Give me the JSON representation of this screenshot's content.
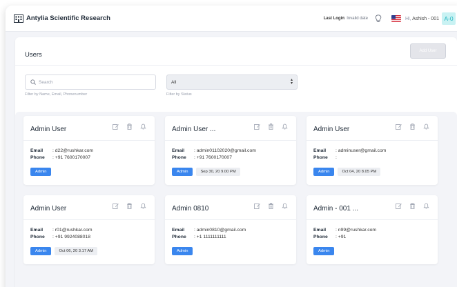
{
  "header": {
    "brand": "Antylia Scientific Research",
    "last_login_label": "Last Login",
    "last_login_value": ": Invalid date",
    "greeting_prefix": "Hi,",
    "user_name": "Ashish - 001",
    "avatar_initials": "A-0",
    "icons": [
      "building-icon",
      "lightbulb-icon",
      "us-flag-icon"
    ]
  },
  "page": {
    "title": "Users",
    "add_button_label": "Add User"
  },
  "filters": {
    "search_placeholder": "Search",
    "search_value": "",
    "search_hint": "Filter by Name, Email, Phonenumber",
    "status_value": "All",
    "status_hint": "Filter by Status"
  },
  "colors": {
    "accent": "#3a86ee",
    "avatar_bg": "#c9f2f3",
    "avatar_fg": "#21b4c0"
  },
  "labels": {
    "email": "Email",
    "phone": "Phone",
    "colon": ":"
  },
  "cards": [
    {
      "name": "Admin User",
      "email": ": d22@rushkar.com",
      "phone": ": +91 7600170007",
      "role": "Admin",
      "date": ""
    },
    {
      "name": "Admin User ...",
      "email": ": admin01102020@gmail.com",
      "phone": ": +91 7600170007",
      "role": "Admin",
      "date": "Sep 30, 20 9.00 PM"
    },
    {
      "name": "Admin User",
      "email": ": adminuser@gmail.com",
      "phone": ":",
      "role": "Admin",
      "date": "Oct 04, 20 8.05 PM"
    },
    {
      "name": "Admin User",
      "email": ": r01@rushkar.com",
      "phone": ": +91 9924088018",
      "role": "Admin",
      "date": "Oct 06, 20 3.17 AM"
    },
    {
      "name": "Admin 0810",
      "email": ": admin0810@gmail.com",
      "phone": ": +1 1111111111",
      "role": "Admin",
      "date": ""
    },
    {
      "name": "Admin - 001 ...",
      "email": ": n99@rushkar.com",
      "phone": ": +91",
      "role": "Admin",
      "date": ""
    }
  ]
}
